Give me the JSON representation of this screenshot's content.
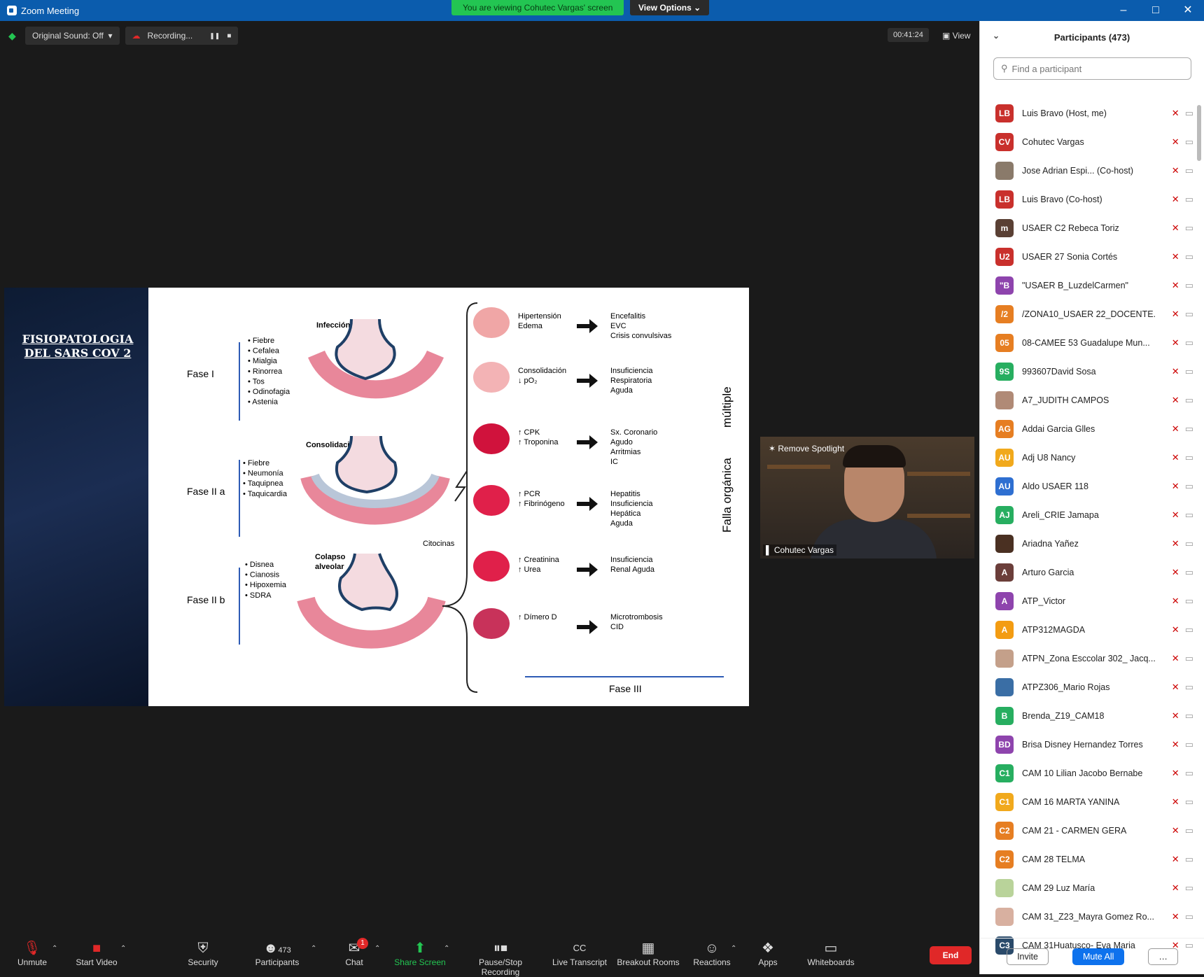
{
  "window": {
    "title": "Zoom Meeting",
    "viewing_banner": "You are viewing Cohutec Vargas' screen",
    "view_options": "View Options ⌄",
    "min": "–",
    "max": "□",
    "close": "✕"
  },
  "topbar": {
    "sound": "Original Sound: Off",
    "recording": "Recording...",
    "pause": "❚❚",
    "stop": "■",
    "timer": "00:41:24",
    "view": "View"
  },
  "slide": {
    "title_line1": "FISIOPATOLOGIA",
    "title_line2": "DEL SARS COV 2",
    "phase1": "Fase I",
    "phase2a": "Fase II a",
    "phase2b": "Fase II b",
    "phase3": "Fase III",
    "infeccion": "Infección",
    "consolidacion": "Consolidación",
    "colapso1": "Colapso",
    "colapso2": "alveolar",
    "citocinas": "Citocinas",
    "f1_symptoms": [
      "Fiebre",
      "Cefalea",
      "Mialgia",
      "Rinorrea",
      "Tos",
      "Odinofagia",
      "Astenia"
    ],
    "f2a_symptoms": [
      "Fiebre",
      "Neumonía",
      "Taquipnea",
      "Taquicardia"
    ],
    "f2b_symptoms": [
      "Disnea",
      "Cianosis",
      "Hipoxemia",
      "SDRA"
    ],
    "falla1": "Falla orgánica",
    "falla2": "múltiple",
    "organs": [
      {
        "markers": [
          "Hipertensión",
          "Edema"
        ],
        "outcome": [
          "Encefalitis",
          "EVC",
          "Crisis convulsivas"
        ]
      },
      {
        "markers": [
          "Consolidación",
          "↓ pO₂"
        ],
        "outcome": [
          "Insuficiencia",
          "Respiratoria",
          "Aguda"
        ]
      },
      {
        "markers": [
          "↑ CPK",
          "↑ Troponina"
        ],
        "outcome": [
          "Sx. Coronario",
          "Agudo",
          "Arritmias",
          "IC"
        ]
      },
      {
        "markers": [
          "↑ PCR",
          "↑ Fibrinógeno"
        ],
        "outcome": [
          "Hepatitis",
          "Insuficiencia",
          "Hepática",
          "Aguda"
        ]
      },
      {
        "markers": [
          "↑ Creatinina",
          "↑ Urea"
        ],
        "outcome": [
          "Insuficiencia",
          "Renal Aguda"
        ]
      },
      {
        "markers": [
          "↑ Dímero D"
        ],
        "outcome": [
          "Microtrombosis",
          "CID"
        ]
      }
    ]
  },
  "video": {
    "spotlight": "Remove Spotlight",
    "name": "Cohutec Vargas"
  },
  "participants": {
    "title": "Participants (473)",
    "search_placeholder": "Find a participant",
    "list": [
      {
        "initials": "LB",
        "color": "#c9302c",
        "name": "Luis Bravo (Host, me)"
      },
      {
        "initials": "CV",
        "color": "#c9302c",
        "name": "Cohutec Vargas"
      },
      {
        "initials": "",
        "color": "#8a7a6a",
        "name": "Jose Adrian Espi...  (Co-host)"
      },
      {
        "initials": "LB",
        "color": "#c9302c",
        "name": "Luis Bravo (Co-host)"
      },
      {
        "initials": "m",
        "color": "#5a4034",
        "name": "USAER C2 Rebeca Toriz"
      },
      {
        "initials": "U2",
        "color": "#c9302c",
        "name": " USAER 27 Sonia Cortés"
      },
      {
        "initials": "\"B",
        "color": "#8e44ad",
        "name": "\"USAER B_LuzdelCarmen\""
      },
      {
        "initials": "/2",
        "color": "#e67e22",
        "name": "/ZONA10_USAER 22_DOCENTE..."
      },
      {
        "initials": "05",
        "color": "#e67e22",
        "name": "08-CAMEE 53 Guadalupe Mun..."
      },
      {
        "initials": "9S",
        "color": "#27ae60",
        "name": "993607David Sosa"
      },
      {
        "initials": "",
        "color": "#b08a76",
        "name": "A7_JUDITH CAMPOS"
      },
      {
        "initials": "AG",
        "color": "#e67e22",
        "name": "Addai Garcia Glles"
      },
      {
        "initials": "AU",
        "color": "#f1a91c",
        "name": "Adj U8 Nancy"
      },
      {
        "initials": "AU",
        "color": "#2e6fd1",
        "name": "Aldo USAER 118"
      },
      {
        "initials": "AJ",
        "color": "#27ae60",
        "name": "Areli_CRIE Jamapa"
      },
      {
        "initials": "",
        "color": "#4a3022",
        "name": "Ariadna Yañez"
      },
      {
        "initials": "A",
        "color": "#6b3e3a",
        "name": "Arturo Garcia"
      },
      {
        "initials": "A",
        "color": "#8e44ad",
        "name": "ATP_Victor"
      },
      {
        "initials": "A",
        "color": "#f39c12",
        "name": "ATP312MAGDA"
      },
      {
        "initials": "",
        "color": "#c4a08a",
        "name": "ATPN_Zona Esccolar 302_ Jacq..."
      },
      {
        "initials": "",
        "color": "#3a6ea5",
        "name": "ATPZ306_Mario Rojas"
      },
      {
        "initials": "B",
        "color": "#27ae60",
        "name": "Brenda_Z19_CAM18"
      },
      {
        "initials": "BD",
        "color": "#8e44ad",
        "name": "Brisa Disney Hernandez Torres"
      },
      {
        "initials": "C1",
        "color": "#27ae60",
        "name": "CAM 10 Lilian Jacobo Bernabe"
      },
      {
        "initials": "C1",
        "color": "#f1a91c",
        "name": "CAM 16 MARTA YANINA"
      },
      {
        "initials": "C2",
        "color": "#e67e22",
        "name": "CAM 21 - CARMEN GERA"
      },
      {
        "initials": "C2",
        "color": "#e67e22",
        "name": "CAM 28 TELMA"
      },
      {
        "initials": "",
        "color": "#b9d39a",
        "name": "CAM 29 Luz María"
      },
      {
        "initials": "",
        "color": "#d8b0a0",
        "name": "CAM 31_Z23_Mayra Gomez Ro..."
      },
      {
        "initials": "C3",
        "color": "#2a4a6a",
        "name": "CAM 31Huatusco- Eva Maria"
      }
    ],
    "invite": "Invite",
    "mute_all": "Mute All",
    "more": "…"
  },
  "toolbar": {
    "unmute": "Unmute",
    "start_video": "Start Video",
    "security": "Security",
    "participants_count": "473",
    "participants": "Participants",
    "chat": "Chat",
    "chat_badge": "1",
    "share": "Share Screen",
    "pause_rec": "Pause/Stop Recording",
    "transcript": "Live Transcript",
    "breakout": "Breakout Rooms",
    "reactions": "Reactions",
    "apps": "Apps",
    "whiteboards": "Whiteboards",
    "end": "End"
  }
}
